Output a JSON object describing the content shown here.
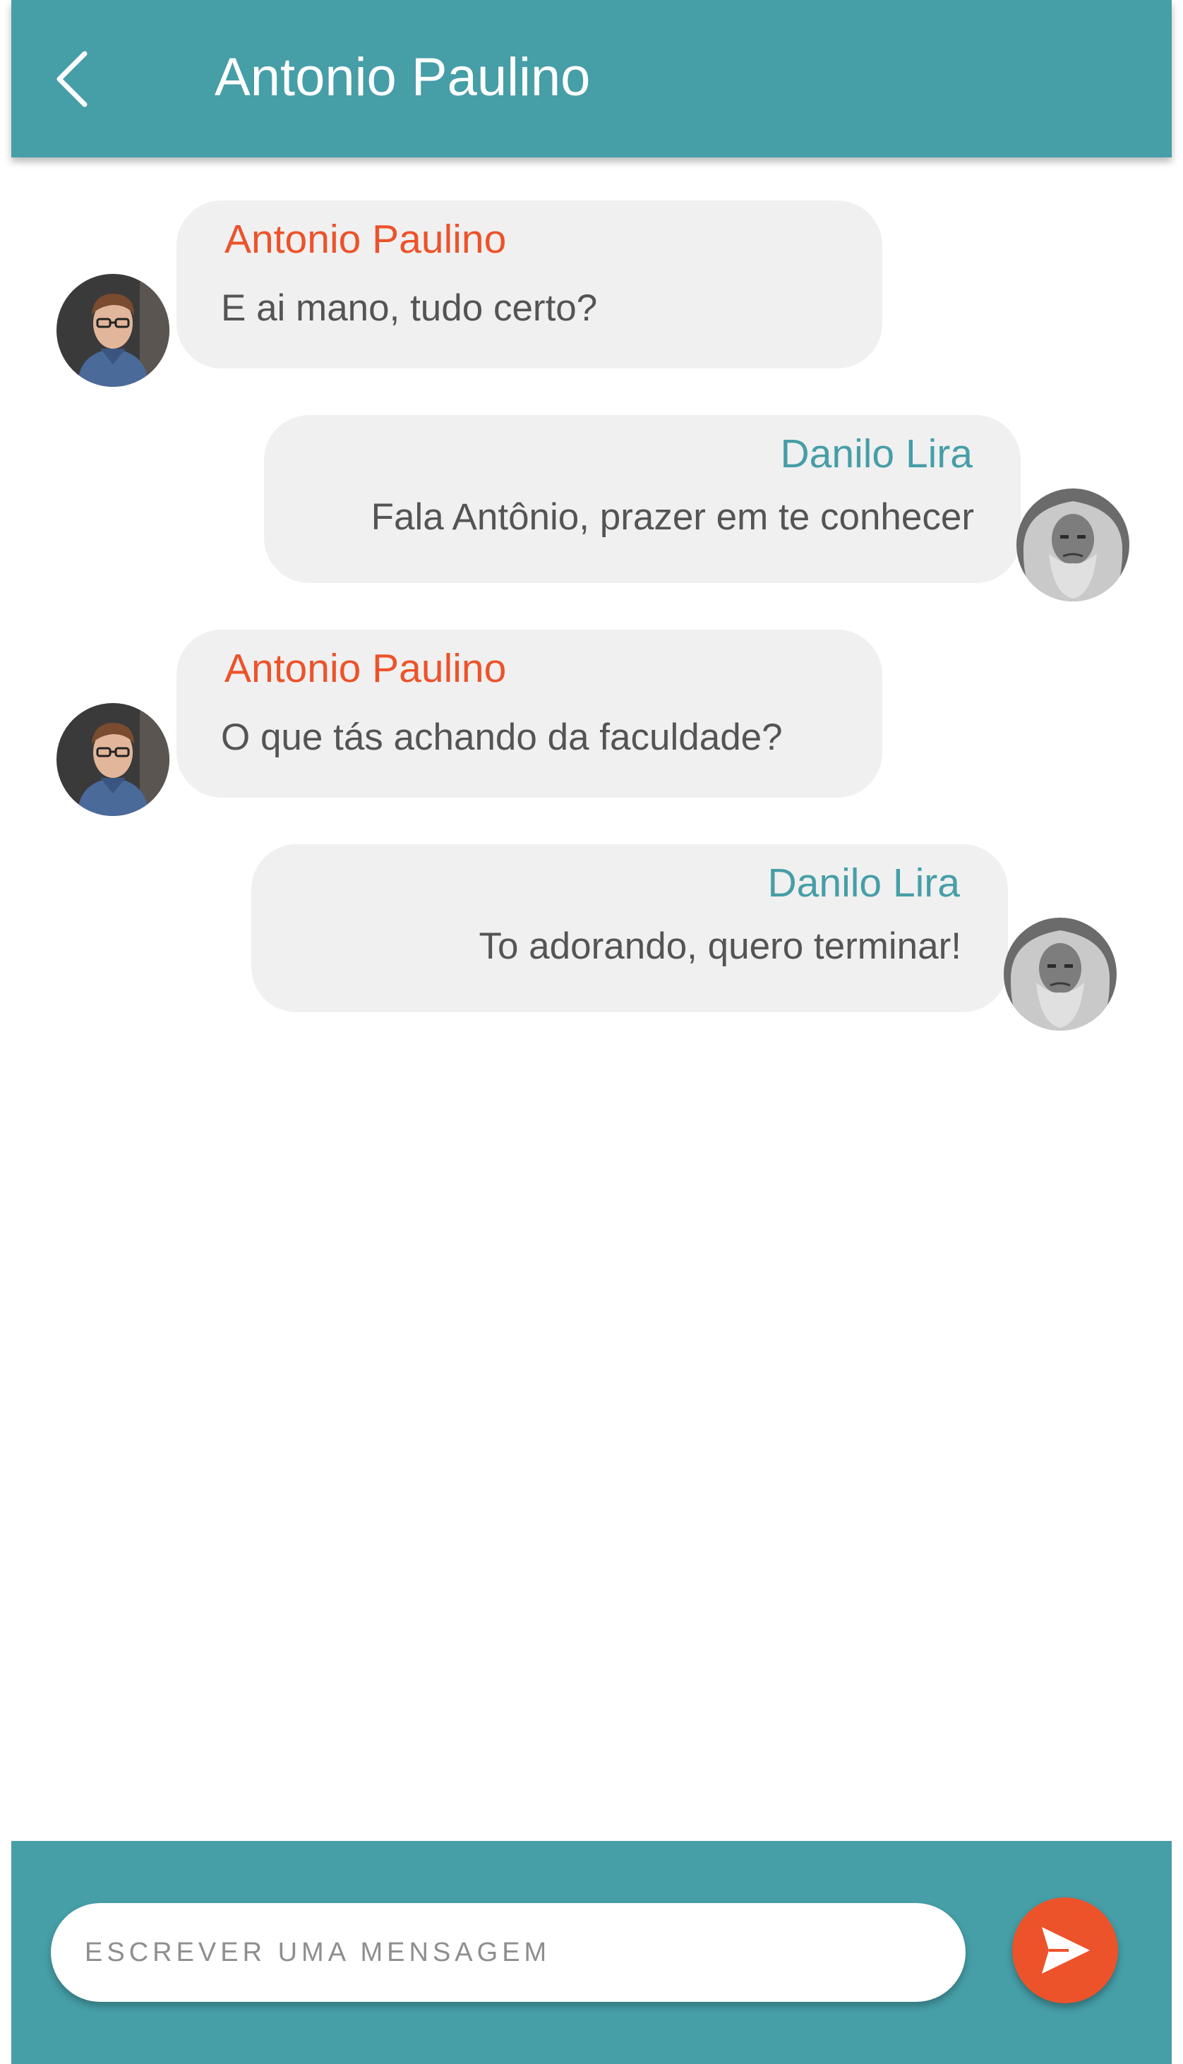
{
  "header": {
    "title": "Antonio Paulino"
  },
  "colors": {
    "appbar": "#469ea7",
    "incoming_name": "#ec532b",
    "outgoing_name": "#469ea7",
    "bubble": "#f0f0f0",
    "message_text": "#545454",
    "send_button": "#ec532b"
  },
  "messages": [
    {
      "sender": "Antonio Paulino",
      "text": "E ai mano, tudo certo?",
      "direction": "incoming"
    },
    {
      "sender": "Danilo Lira",
      "text": "Fala Antônio, prazer em te conhecer",
      "direction": "outgoing"
    },
    {
      "sender": "Antonio Paulino",
      "text": "O que tás achando da faculdade?",
      "direction": "incoming"
    },
    {
      "sender": "Danilo Lira",
      "text": "To adorando, quero terminar!",
      "direction": "outgoing"
    }
  ],
  "composer": {
    "placeholder": "ESCREVER UMA MENSAGEM",
    "value": ""
  },
  "icons": {
    "back": "chevron-left-icon",
    "send": "send-icon"
  }
}
